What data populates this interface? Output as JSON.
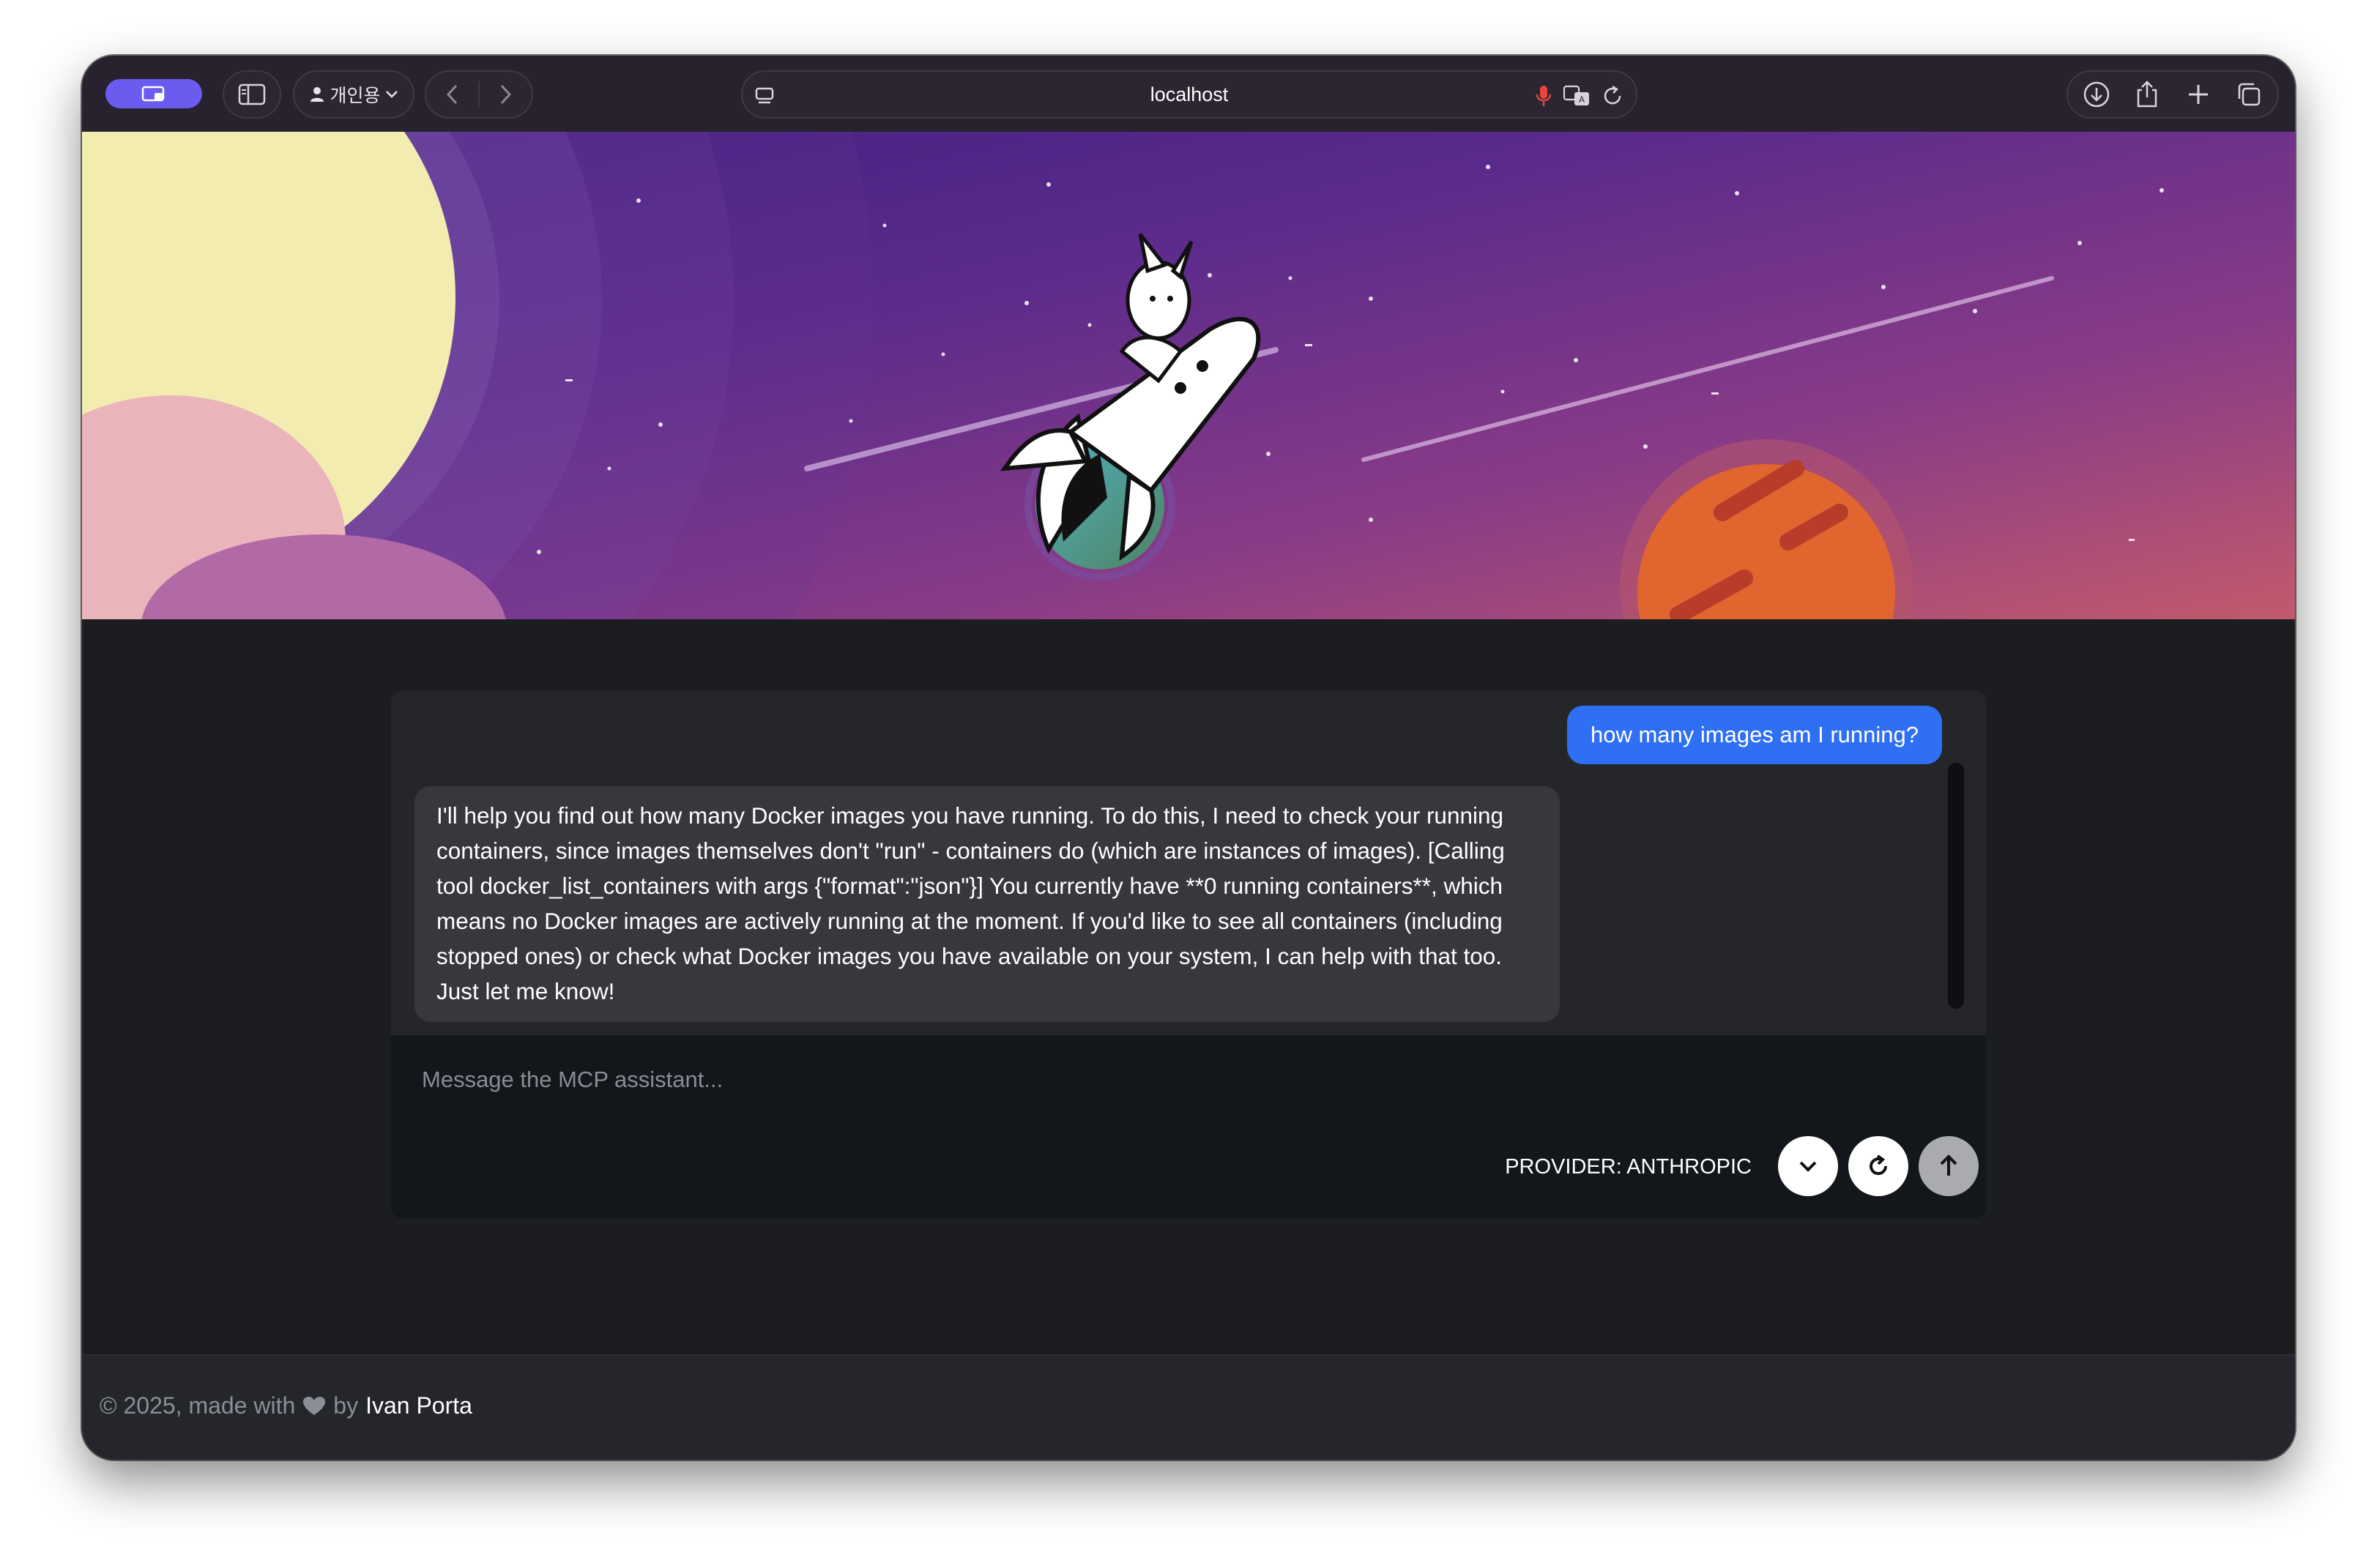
{
  "browser": {
    "url": "localhost",
    "profile_label": "개인용"
  },
  "chat": {
    "user_message": "how many images am I running?",
    "assistant_message": "I'll help you find out how many Docker images you have running. To do this, I need to check your running containers, since images themselves don't \"run\" - containers do (which are instances of images). [Calling tool docker_list_containers with args {\"format\":\"json\"}] You currently have **0 running containers**, which means no Docker images are actively running at the moment. If you'd like to see all containers (including stopped ones) or check what Docker images you have available on your system, I can help with that too. Just let me know!",
    "input_placeholder": "Message the MCP assistant...",
    "input_value": "",
    "provider_label": "PROVIDER: ANTHROPIC"
  },
  "footer": {
    "prefix": "© 2025, made with",
    "by": "by",
    "author": "Ivan Porta"
  },
  "icons": {
    "sidebar": "sidebar-icon",
    "person": "person-icon",
    "chevron_down": "chevron-down-icon",
    "back": "back-arrow-icon",
    "forward": "forward-arrow-icon",
    "page": "page-menu-icon",
    "microphone": "microphone-icon",
    "translate": "translate-icon",
    "reload": "reload-icon",
    "download": "download-icon",
    "share": "share-icon",
    "new_tab": "plus-icon",
    "tabs_overview": "tabs-overview-icon",
    "heart": "heart-icon",
    "send": "arrow-up-icon"
  },
  "colors": {
    "accent_blue": "#2f6ff3",
    "profile_pill": "#6b5cf0",
    "background": "#1b1d21",
    "mic_red": "#e8463f"
  }
}
